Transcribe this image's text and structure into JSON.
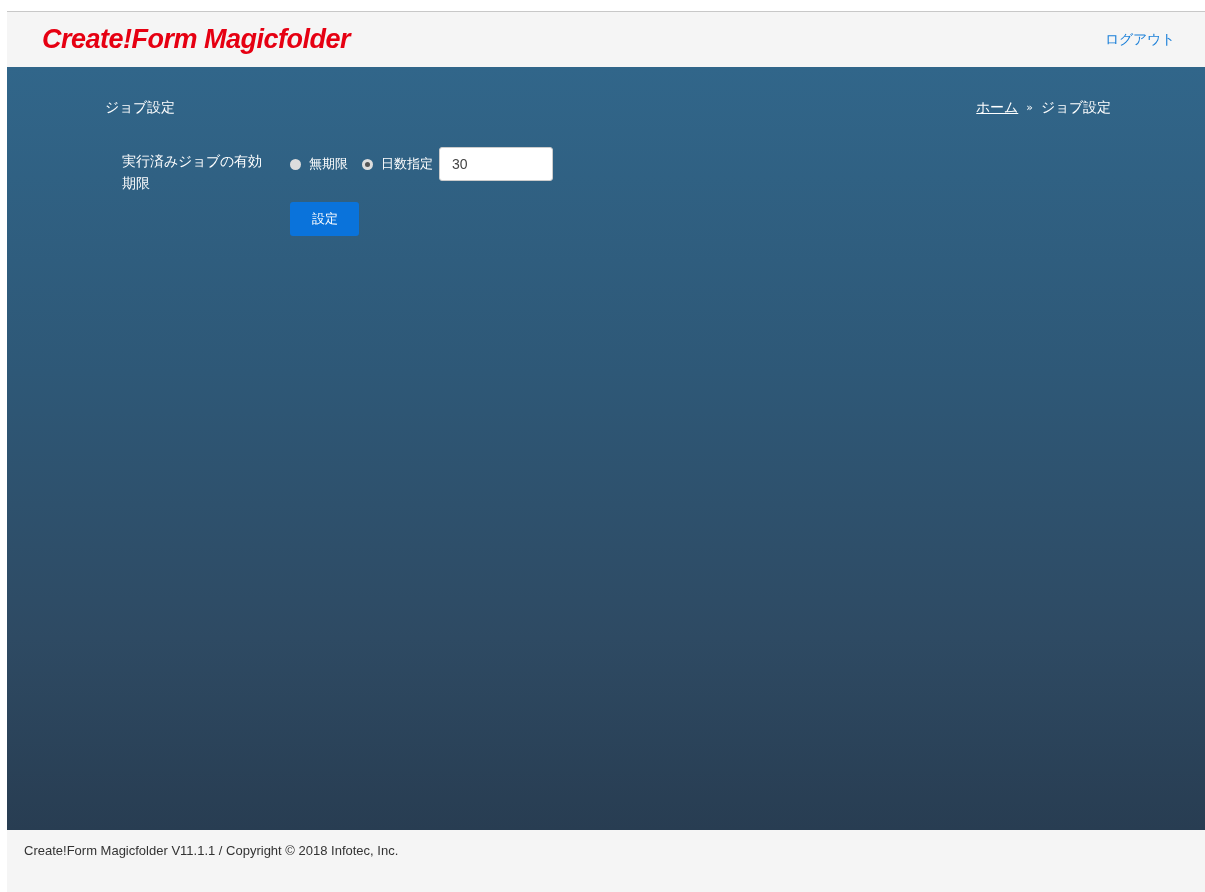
{
  "header": {
    "logo": "Create!Form Magicfolder",
    "logout": "ログアウト"
  },
  "page_title": "ジョブ設定",
  "breadcrumb": {
    "home": "ホーム",
    "separator": "»",
    "current": "ジョブ設定"
  },
  "setting": {
    "label": "実行済みジョブの有効期限",
    "options": [
      {
        "label": "無期限",
        "selected": false
      },
      {
        "label": "日数指定",
        "selected": true
      }
    ],
    "days": {
      "value": "30"
    },
    "submit": "設定"
  },
  "footer": "Create!Form Magicfolder V11.1.1 / Copyright © 2018 Infotec, Inc."
}
